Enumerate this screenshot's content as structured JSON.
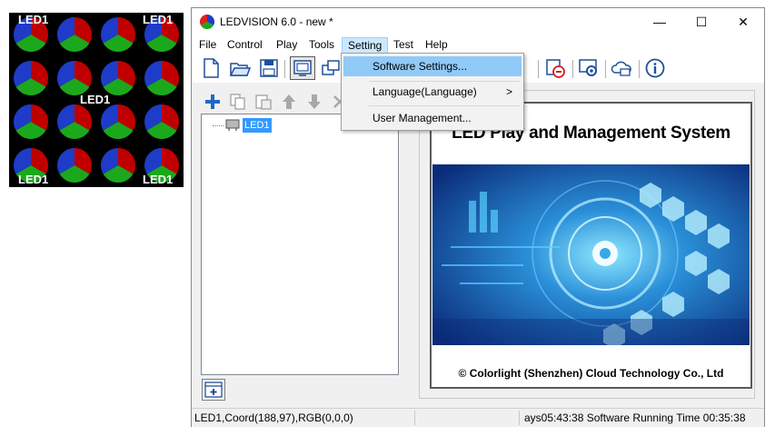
{
  "led_preview": {
    "labels": [
      "LED1",
      "LED1",
      "LED1",
      "LED1",
      "LED1"
    ],
    "colors": {
      "red": "#c00000",
      "blue": "#1e3cc8",
      "green": "#1ca81c"
    }
  },
  "window": {
    "title": "LEDVISION 6.0 - new *",
    "controls": {
      "minimize": "—",
      "maximize": "☐",
      "close": "✕"
    }
  },
  "menu": {
    "items": [
      "File",
      "Control",
      "Play",
      "Tools",
      "Setting",
      "Test",
      "Help"
    ],
    "active": "Setting"
  },
  "setting_menu": {
    "items": [
      {
        "label": "Software Settings...",
        "has_submenu": false
      },
      {
        "label": "Language(Language)",
        "has_submenu": true,
        "arrow": ">"
      },
      {
        "label": "User Management...",
        "has_submenu": false
      }
    ]
  },
  "toolbar": {
    "buttons": [
      "new-file-icon",
      "open-folder-icon",
      "save-icon",
      "display-window-icon",
      "window-arrange-icon",
      "stop-icon",
      "settings-icon",
      "cloud-icon",
      "info-icon"
    ]
  },
  "left_toolbar": {
    "buttons": [
      "add-icon",
      "copy-icon",
      "paste-icon",
      "move-up-icon",
      "move-down-icon",
      "delete-icon"
    ]
  },
  "tree": {
    "item_label": "LED1"
  },
  "splash": {
    "title": "LED Play and Management System",
    "copyright": "© Colorlight (Shenzhen) Cloud Technology Co., Ltd"
  },
  "status": {
    "left": "LED1,Coord(188,97),RGB(0,0,0)",
    "right": "ays05:43:38 Software Running Time 00:35:38"
  },
  "accent_colors": {
    "menu_active_bg": "#cce8ff",
    "dropdown_hover": "#91c9f7",
    "tree_selection": "#3399ff"
  }
}
